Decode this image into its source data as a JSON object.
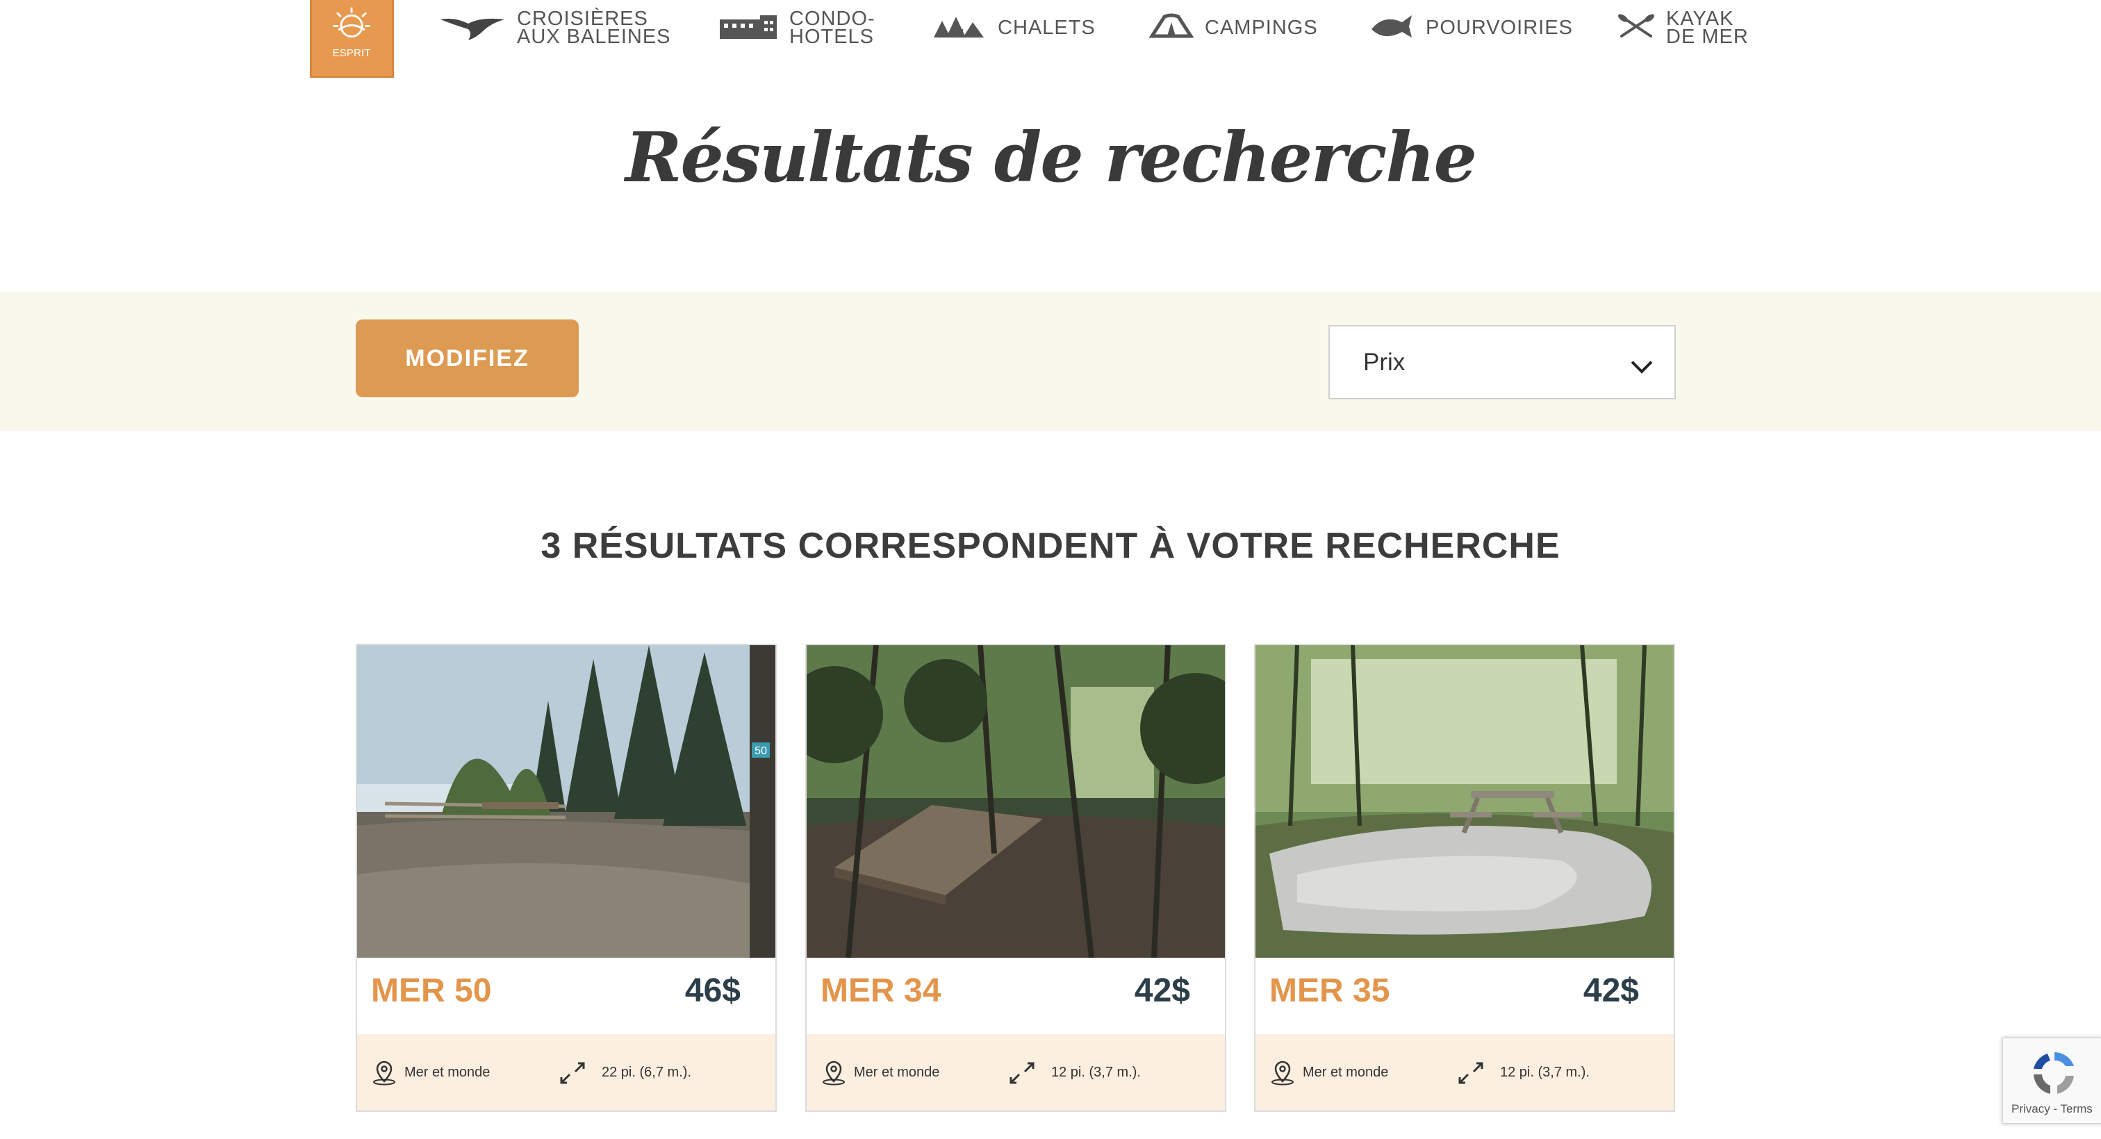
{
  "nav": {
    "items": [
      {
        "label": "CROISIÈRES\nAUX BALEINES",
        "icon": "whale-icon"
      },
      {
        "label": "CONDO-\nHOTELS",
        "icon": "building-icon"
      },
      {
        "label": "CHALETS",
        "icon": "chalet-icon"
      },
      {
        "label": "CAMPINGS",
        "icon": "tent-icon"
      },
      {
        "label": "POURVOIRIES",
        "icon": "fish-icon"
      },
      {
        "label": "KAYAK\nDE MER",
        "icon": "paddles-icon"
      }
    ],
    "logo_text": "ESPRIT"
  },
  "page": {
    "title": "Résultats de recherche"
  },
  "filters": {
    "modify_label": "MODIFIEZ",
    "sort_value": "Prix"
  },
  "results": {
    "heading": "3 RÉSULTATS CORRESPONDENT À VOTRE RECHERCHE",
    "cards": [
      {
        "name": "MER 50",
        "price": "46$",
        "location": "Mer et monde",
        "size": "22 pi. (6,7 m.).",
        "post_number": "50"
      },
      {
        "name": "MER 34",
        "price": "42$",
        "location": "Mer et monde",
        "size": "12 pi. (3,7 m.)."
      },
      {
        "name": "MER 35",
        "price": "42$",
        "location": "Mer et monde",
        "size": "12 pi. (3,7 m.)."
      }
    ]
  },
  "recaptcha": {
    "links": "Privacy - Terms"
  },
  "colors": {
    "accent": "#dd9a52",
    "price": "#2c3e4a",
    "filter_bg": "#f9f8ec",
    "meta_bg": "#fcefe0"
  }
}
